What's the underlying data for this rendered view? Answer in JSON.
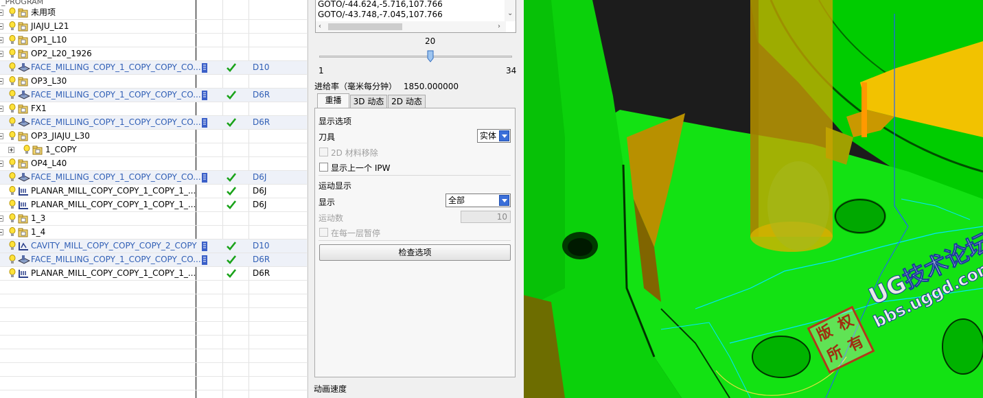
{
  "tree": {
    "header": "_PROGRAM",
    "rows": [
      {
        "name": "未用项",
        "kind": "folder",
        "indent": 1,
        "tool": "",
        "check": false,
        "meta": false,
        "style": "black"
      },
      {
        "name": "JIAJU_L21",
        "kind": "folder",
        "indent": 1,
        "tool": "",
        "check": false,
        "meta": false,
        "style": "black"
      },
      {
        "name": "OP1_L10",
        "kind": "folder",
        "indent": 1,
        "tool": "",
        "check": false,
        "meta": false,
        "style": "black"
      },
      {
        "name": "OP2_L20_1926",
        "kind": "folder",
        "indent": 1,
        "tool": "",
        "check": false,
        "meta": false,
        "style": "black"
      },
      {
        "name": "FACE_MILLING_COPY_1_COPY_COPY_CO...",
        "kind": "face",
        "indent": 1,
        "tool": "D10",
        "check": true,
        "meta": true,
        "style": "op"
      },
      {
        "name": "OP3_L30",
        "kind": "folder",
        "indent": 1,
        "tool": "",
        "check": false,
        "meta": false,
        "style": "black"
      },
      {
        "name": "FACE_MILLING_COPY_1_COPY_COPY_CO...",
        "kind": "face",
        "indent": 1,
        "tool": "D6R",
        "check": true,
        "meta": true,
        "style": "op"
      },
      {
        "name": "FX1",
        "kind": "folder",
        "indent": 1,
        "tool": "",
        "check": false,
        "meta": false,
        "style": "black"
      },
      {
        "name": "FACE_MILLING_COPY_1_COPY_COPY_CO...",
        "kind": "face",
        "indent": 1,
        "tool": "D6R",
        "check": true,
        "meta": true,
        "style": "op"
      },
      {
        "name": "OP3_JIAJU_L30",
        "kind": "folder",
        "indent": 1,
        "tool": "",
        "check": false,
        "meta": false,
        "style": "black"
      },
      {
        "name": "1_COPY",
        "kind": "folder",
        "indent": 2,
        "tool": "",
        "check": false,
        "meta": false,
        "style": "black"
      },
      {
        "name": "OP4_L40",
        "kind": "folder",
        "indent": 1,
        "tool": "",
        "check": false,
        "meta": false,
        "style": "black"
      },
      {
        "name": "FACE_MILLING_COPY_1_COPY_COPY_CO...",
        "kind": "face",
        "indent": 1,
        "tool": "D6J",
        "check": true,
        "meta": true,
        "style": "op"
      },
      {
        "name": "PLANAR_MILL_COPY_COPY_1_COPY_1_...",
        "kind": "planar",
        "indent": 1,
        "tool": "D6J",
        "check": true,
        "meta": false,
        "style": "black"
      },
      {
        "name": "PLANAR_MILL_COPY_COPY_1_COPY_1_...",
        "kind": "planar",
        "indent": 1,
        "tool": "D6J",
        "check": true,
        "meta": false,
        "style": "black"
      },
      {
        "name": "1_3",
        "kind": "folder",
        "indent": 1,
        "tool": "",
        "check": false,
        "meta": false,
        "style": "black"
      },
      {
        "name": "1_4",
        "kind": "folder",
        "indent": 1,
        "tool": "",
        "check": false,
        "meta": false,
        "style": "black"
      },
      {
        "name": "CAVITY_MILL_COPY_COPY_COPY_2_COPY",
        "kind": "cavity",
        "indent": 1,
        "tool": "D10",
        "check": true,
        "meta": true,
        "style": "op"
      },
      {
        "name": "FACE_MILLING_COPY_1_COPY_COPY_CO...",
        "kind": "face",
        "indent": 1,
        "tool": "D6R",
        "check": true,
        "meta": true,
        "style": "op"
      },
      {
        "name": "PLANAR_MILL_COPY_COPY_1_COPY_1_...",
        "kind": "planar",
        "indent": 1,
        "tool": "D6R",
        "check": true,
        "meta": false,
        "style": "black"
      }
    ]
  },
  "panel": {
    "goto_lines": [
      "GOTO/-44.624,-5.716,107.766",
      "GOTO/-43.748,-7.045,107.766"
    ],
    "slider": {
      "value": "20",
      "min": "1",
      "max": "34",
      "fraction": 0.576
    },
    "feed_label": "进给率（毫米每分钟）",
    "feed_value": "1850.000000",
    "tabs": [
      "重播",
      "3D 动态",
      "2D 动态"
    ],
    "display_options_title": "显示选项",
    "tool_label": "刀具",
    "tool_value": "实体",
    "material_removal_2d": "2D 材料移除",
    "show_prev_ipw": "显示上一个 IPW",
    "motion_display_title": "运动显示",
    "display_label": "显示",
    "display_value": "全部",
    "motion_count_label": "运动数",
    "motion_count_value": "10",
    "pause_each_layer": "在每一层暂停",
    "check_options_button": "检查选项",
    "animation_speed_label": "动画速度"
  },
  "viewport": {
    "watermark_title": "UG技术论坛",
    "watermark_url": "bbs.uggd.com",
    "stamp_chars": [
      "版",
      "权",
      "所",
      "有"
    ],
    "colors": {
      "part": "#00dd00",
      "tool": "#c8a000",
      "path": "#00e0ff",
      "bg": "#1a1a1a"
    }
  }
}
